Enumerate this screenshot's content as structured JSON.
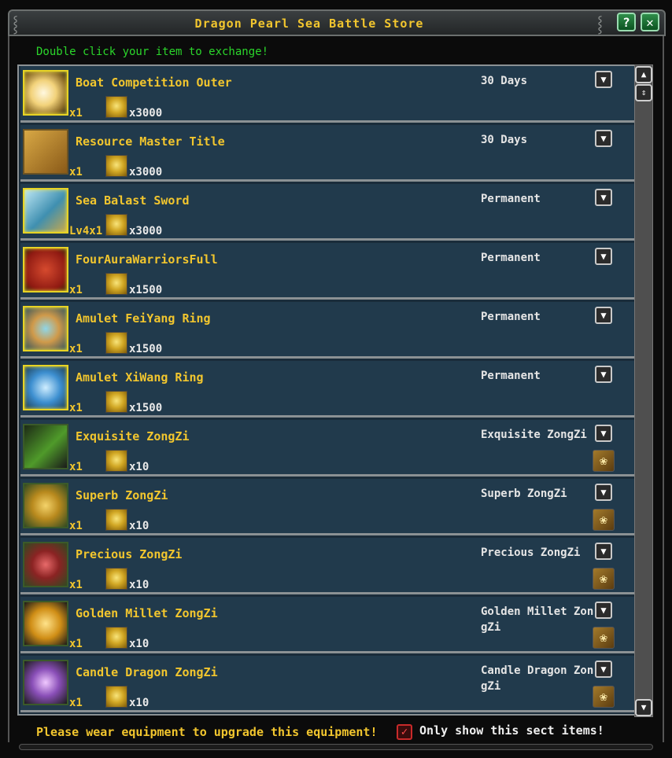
{
  "window": {
    "title": "Dragon Pearl Sea Battle Store",
    "help_label": "?",
    "close_label": "✕"
  },
  "hint": "Double click your item to exchange!",
  "items": [
    {
      "name": "Boat Competition Outer",
      "qty": "x1",
      "price": "x3000",
      "duration": "30 Days",
      "icon": "gift-box-icon",
      "has_scroll": false
    },
    {
      "name": "Resource Master Title",
      "qty": "x1",
      "price": "x3000",
      "duration": "30 Days",
      "icon": "title-scroll-icon",
      "has_scroll": false
    },
    {
      "name": "Sea Balast Sword",
      "qty": "Lv4x1",
      "price": "x3000",
      "duration": "Permanent",
      "icon": "sword-icon",
      "has_scroll": false
    },
    {
      "name": "FourAuraWarriorsFull",
      "qty": "x1",
      "price": "x1500",
      "duration": "Permanent",
      "icon": "red-book-icon",
      "has_scroll": false
    },
    {
      "name": "Amulet FeiYang Ring",
      "qty": "x1",
      "price": "x1500",
      "duration": "Permanent",
      "icon": "ring-icon",
      "has_scroll": false
    },
    {
      "name": "Amulet XiWang Ring",
      "qty": "x1",
      "price": "x1500",
      "duration": "Permanent",
      "icon": "blue-ring-icon",
      "has_scroll": false
    },
    {
      "name": "Exquisite ZongZi",
      "qty": "x1",
      "price": "x10",
      "duration": "Exquisite ZongZi",
      "icon": "zongzi-leaf-icon",
      "has_scroll": true
    },
    {
      "name": "Superb ZongZi",
      "qty": "x1",
      "price": "x10",
      "duration": "Superb ZongZi",
      "icon": "golden-box-icon",
      "has_scroll": true
    },
    {
      "name": "Precious ZongZi",
      "qty": "x1",
      "price": "x10",
      "duration": "Precious ZongZi",
      "icon": "red-box-icon",
      "has_scroll": true
    },
    {
      "name": "Golden Millet ZongZi",
      "qty": "x1",
      "price": "x10",
      "duration": "Golden Millet ZongZi",
      "icon": "gourd-icon",
      "has_scroll": true
    },
    {
      "name": "Candle Dragon ZongZi",
      "qty": "x1",
      "price": "x10",
      "duration": "Candle Dragon ZongZi",
      "icon": "purple-orb-icon",
      "has_scroll": true
    }
  ],
  "footer": {
    "message": "Please wear equipment to upgrade this equipment!",
    "checkbox_label": "Only show this sect items!",
    "checkbox_checked": true
  },
  "colors": {
    "accent_gold": "#f2c62e",
    "hint_green": "#2bd62b",
    "row_bg": "#213a4c"
  }
}
